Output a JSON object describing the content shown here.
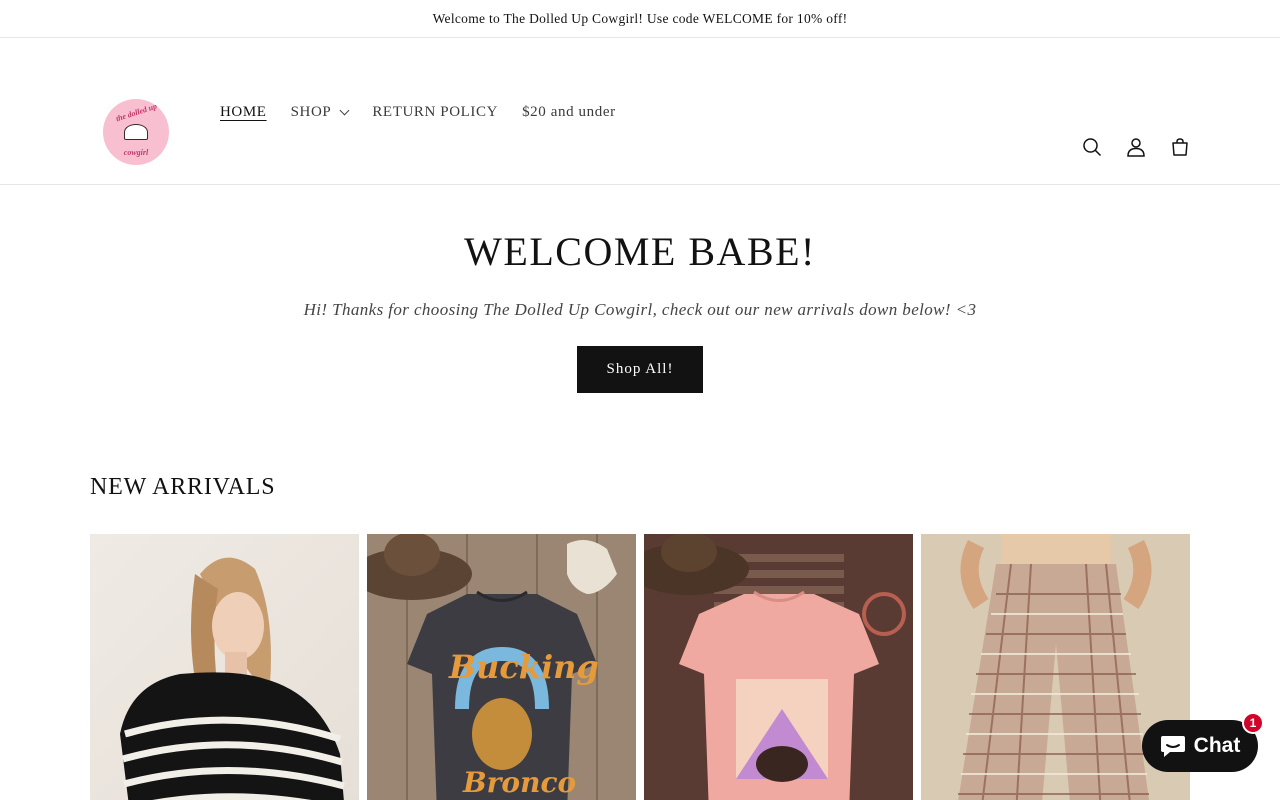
{
  "announcement": {
    "text": "Welcome to The Dolled Up Cowgirl! Use code WELCOME for 10% off!"
  },
  "header": {
    "logo": {
      "text_top": "the dolled up",
      "text_bottom": "cowgirl"
    },
    "nav": [
      {
        "label": "HOME",
        "active": true
      },
      {
        "label": "SHOP",
        "dropdown": true
      },
      {
        "label": "RETURN POLICY"
      },
      {
        "label": "$20 and under"
      }
    ],
    "icons": [
      "search-icon",
      "account-icon",
      "cart-icon"
    ]
  },
  "hero": {
    "title": "WELCOME BABE!",
    "subtitle": "Hi! Thanks for choosing The Dolled Up Cowgirl, check out our new arrivals down below! <3",
    "button_label": "Shop All!"
  },
  "new_arrivals": {
    "title": "NEW ARRIVALS",
    "products": [
      {
        "image_alt": "striped-sweater"
      },
      {
        "image_alt": "bucking-bronco-tee",
        "graphic_line1": "Bucking",
        "graphic_line2": "Bronco"
      },
      {
        "image_alt": "pink-western-tee"
      },
      {
        "image_alt": "plaid-pants"
      }
    ]
  },
  "chat": {
    "label": "Chat",
    "badge_count": "1"
  },
  "colors": {
    "accent": "#121212",
    "badge": "#d1052a",
    "logo_pink": "#f7bfd0"
  }
}
